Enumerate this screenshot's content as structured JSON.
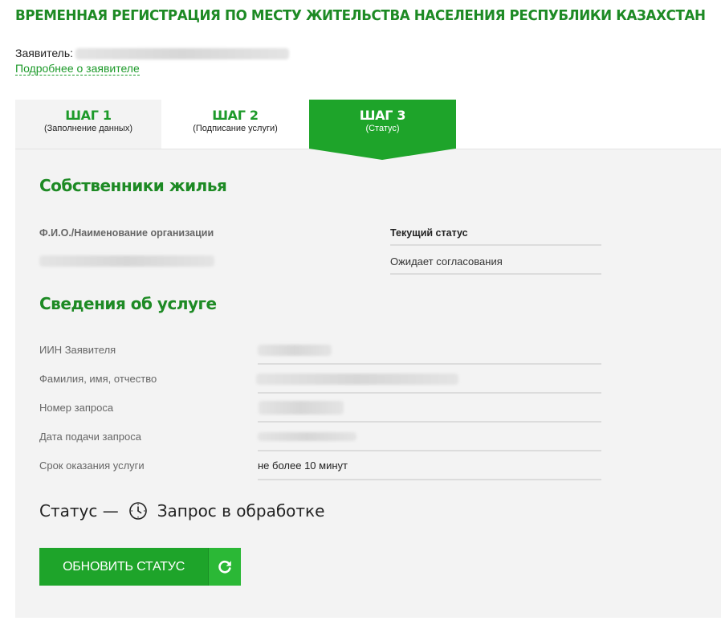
{
  "page": {
    "title": "ВРЕМЕННАЯ РЕГИСТРАЦИЯ ПО МЕСТУ ЖИТЕЛЬСТВА НАСЕЛЕНИЯ РЕСПУБЛИКИ КАЗАХСТАН"
  },
  "applicant": {
    "label": "Заявитель:",
    "details_link": "Подробнее о заявителе"
  },
  "steps": [
    {
      "title": "ШАГ 1",
      "subtitle": "(Заполнение данных)",
      "active": false
    },
    {
      "title": "ШАГ 2",
      "subtitle": "(Подписание услуги)",
      "active": false
    },
    {
      "title": "ШАГ 3",
      "subtitle": "(Статус)",
      "active": true
    }
  ],
  "owners": {
    "title": "Собственники жилья",
    "col_name": "Ф.И.О./Наименование организации",
    "col_status": "Текущий статус",
    "rows": [
      {
        "status": "Ожидает согласования"
      }
    ]
  },
  "service": {
    "title": "Сведения об услуге",
    "rows": [
      {
        "label": "ИИН Заявителя",
        "value": ""
      },
      {
        "label": "Фамилия, имя, отчество",
        "value": ""
      },
      {
        "label": "Номер запроса",
        "value": ""
      },
      {
        "label": "Дата подачи запроса",
        "value": ""
      },
      {
        "label": "Срок оказания услуги",
        "value": "не более 10 минут"
      }
    ]
  },
  "status": {
    "prefix": "Статус —",
    "text": "Запрос в обработке",
    "icon": "clock-icon"
  },
  "refresh_button": {
    "label": "ОБНОВИТЬ СТАТУС",
    "icon": "refresh-icon"
  },
  "colors": {
    "brand_green": "#1ea42a",
    "title_green": "#1d8a24",
    "panel_bg": "#f3f3f3"
  }
}
